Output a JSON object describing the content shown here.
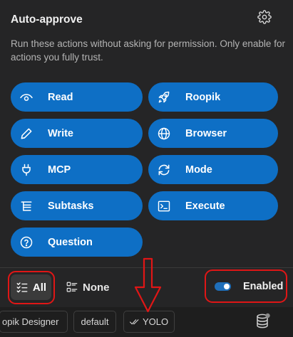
{
  "header": {
    "title": "Auto-approve",
    "description": "Run these actions without asking for permission. Only enable for actions you fully trust."
  },
  "actions": [
    {
      "label": "Read",
      "icon": "eye-icon"
    },
    {
      "label": "Roopik",
      "icon": "rocket-icon"
    },
    {
      "label": "Write",
      "icon": "pencil-icon"
    },
    {
      "label": "Browser",
      "icon": "globe-icon"
    },
    {
      "label": "MCP",
      "icon": "plug-icon"
    },
    {
      "label": "Mode",
      "icon": "refresh-icon"
    },
    {
      "label": "Subtasks",
      "icon": "list-tree-icon"
    },
    {
      "label": "Execute",
      "icon": "terminal-icon"
    },
    {
      "label": "Question",
      "icon": "question-circle-icon"
    }
  ],
  "footer": {
    "all_label": "All",
    "none_label": "None",
    "enabled_label": "Enabled",
    "enabled": true
  },
  "bottom_bar": {
    "mode_chip": "opik Designer",
    "profile_chip": "default",
    "yolo_chip": "YOLO"
  },
  "colors": {
    "accent": "#0e6fc5",
    "annotation": "#e01616",
    "panel": "#252526"
  }
}
